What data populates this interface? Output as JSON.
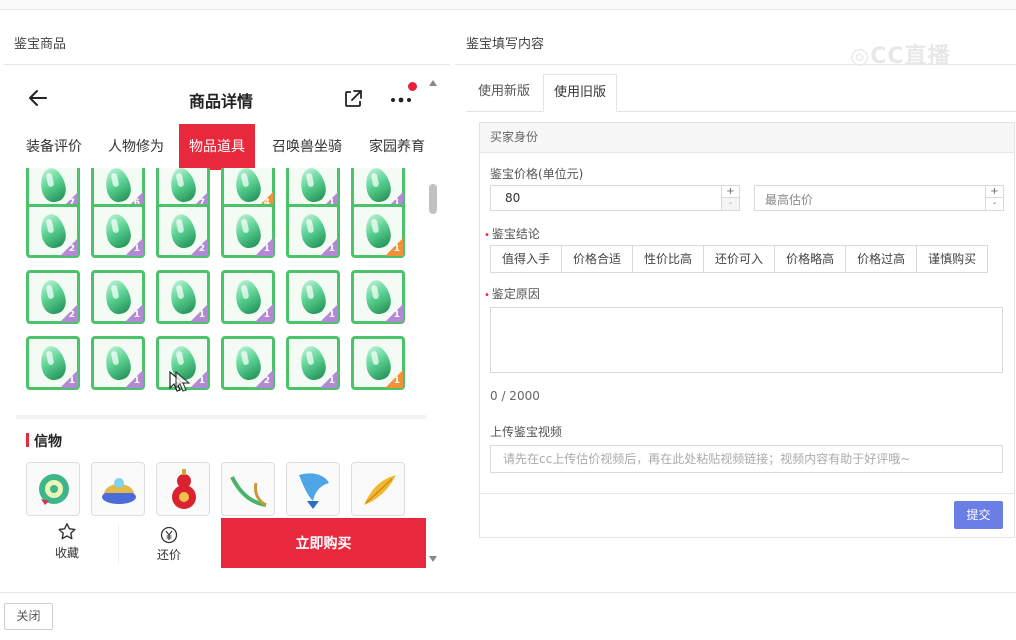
{
  "left_panel": {
    "title": "鉴宝商品",
    "header": {
      "title": "商品详情"
    },
    "tabs": [
      "装备评价",
      "人物修为",
      "物品道具",
      "召唤兽坐骑",
      "家园养育"
    ],
    "active_tab": "物品道具",
    "grid_badges": [
      [
        "7",
        "6",
        "7",
        "4",
        "1",
        "1"
      ],
      [
        "2",
        "1",
        "2",
        "1",
        "1",
        "1"
      ],
      [
        "2",
        "1",
        "1",
        "1",
        "1",
        "1"
      ],
      [
        "1",
        "1",
        "1",
        "2",
        "1",
        "1"
      ]
    ],
    "section_title": "信物",
    "bottom_bar": {
      "favorite_label": "收藏",
      "bargain_label": "还价",
      "buy_label": "立即购买"
    },
    "colors": {
      "accent": "#e8283c",
      "gem_border": "#4cc26a"
    }
  },
  "right_panel": {
    "title": "鉴宝填写内容",
    "tabs": [
      "使用新版",
      "使用旧版"
    ],
    "active_tab": "使用旧版",
    "box_header": "买家身份",
    "price_label": "鉴宝价格(单位元)",
    "price_value": "80",
    "max_price_placeholder": "最高估价",
    "stepper_plus": "+",
    "stepper_minus": "-",
    "conclusion_label": "鉴宝结论",
    "conclusion_options": [
      "值得入手",
      "价格合适",
      "性价比高",
      "还价可入",
      "价格略高",
      "价格过高",
      "谨慎购买"
    ],
    "reason_label": "鉴定原因",
    "counter": "0 / 2000",
    "video_label": "上传鉴宝视频",
    "video_placeholder": "请先在cc上传估价视频后，再在此处粘贴视频链接；视频内容有助于好评哦~",
    "submit_label": "提交",
    "colors": {
      "submit": "#6b7ee6"
    }
  },
  "footer": {
    "close_label": "关闭"
  }
}
